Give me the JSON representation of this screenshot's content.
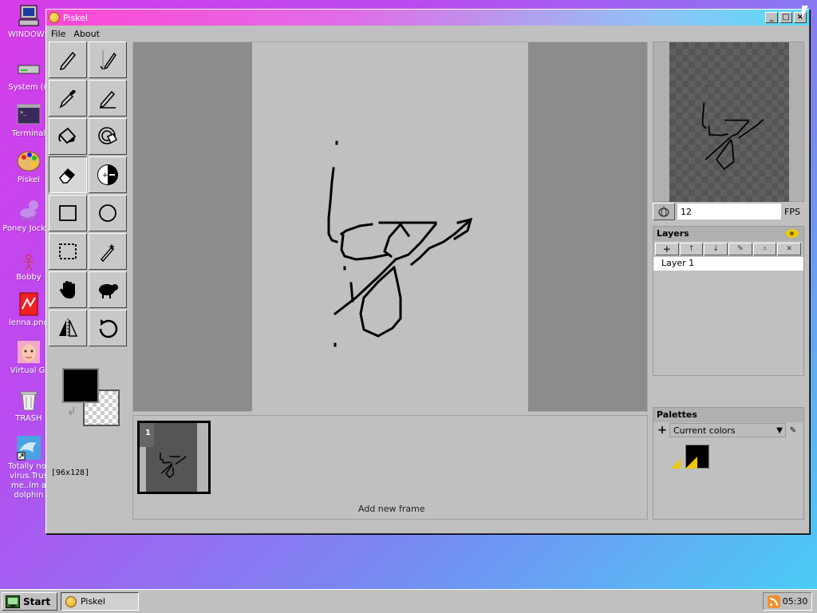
{
  "desktop": {
    "icons": [
      {
        "label": "WINDOWS",
        "icon": "computer-icon"
      },
      {
        "label": "System (C",
        "icon": "drive-icon"
      },
      {
        "label": "Terminal",
        "icon": "terminal-icon"
      },
      {
        "label": "Piskel",
        "icon": "palette-icon"
      },
      {
        "label": "Poney Jockey",
        "icon": "pony-icon"
      },
      {
        "label": "Bobby",
        "icon": "stickman-icon"
      },
      {
        "label": "lenna.png",
        "icon": "image-file-icon"
      },
      {
        "label": "Virtual Gi",
        "icon": "face-icon"
      },
      {
        "label": "TRASH",
        "icon": "trash-icon"
      },
      {
        "label": "Totally not virus.Trus me..im a dolphin",
        "icon": "dolphin-icon"
      }
    ]
  },
  "window": {
    "title": "Piskel",
    "menu": [
      "File",
      "About"
    ],
    "controls": {
      "minimize": "_",
      "maximize": "□",
      "close": "×"
    }
  },
  "tools": [
    {
      "name": "pen-tool",
      "icon": "pen-icon"
    },
    {
      "name": "vertical-mirror-pen-tool",
      "icon": "mirror-pen-icon"
    },
    {
      "name": "color-picker-tool",
      "icon": "eyedropper-icon"
    },
    {
      "name": "stroke-tool",
      "icon": "stroke-pen-icon"
    },
    {
      "name": "paint-bucket-tool",
      "icon": "bucket-icon"
    },
    {
      "name": "paint-all-same-color-tool",
      "icon": "magic-bucket-icon"
    },
    {
      "name": "eraser-tool",
      "icon": "eraser-icon"
    },
    {
      "name": "lighten-tool",
      "icon": "lighten-icon"
    },
    {
      "name": "rectangle-tool",
      "icon": "rectangle-icon"
    },
    {
      "name": "circle-tool",
      "icon": "circle-icon"
    },
    {
      "name": "rectangle-selection-tool",
      "icon": "dashed-rect-icon"
    },
    {
      "name": "magic-wand-tool",
      "icon": "wand-icon"
    },
    {
      "name": "move-tool",
      "icon": "hand-icon"
    },
    {
      "name": "dithering-tool",
      "icon": "sheep-icon"
    },
    {
      "name": "flip-tool",
      "icon": "flip-icon"
    },
    {
      "name": "rotate-tool",
      "icon": "rotate-icon"
    }
  ],
  "colors": {
    "primary": "#000000",
    "secondary": "transparent"
  },
  "canvas": {
    "size_label": "[96x128]"
  },
  "frames": {
    "items": [
      {
        "number": "1"
      }
    ],
    "add_label": "Add new frame"
  },
  "preview": {
    "fps_value": "12",
    "fps_label": "FPS"
  },
  "layers": {
    "title": "Layers",
    "items": [
      {
        "label": "Layer 1"
      }
    ]
  },
  "palettes": {
    "title": "Palettes",
    "selected": "Current colors",
    "swatches": [
      "#000000"
    ]
  },
  "taskbar": {
    "start_label": "Start",
    "task_label": "Piskel",
    "clock": "05:30"
  }
}
